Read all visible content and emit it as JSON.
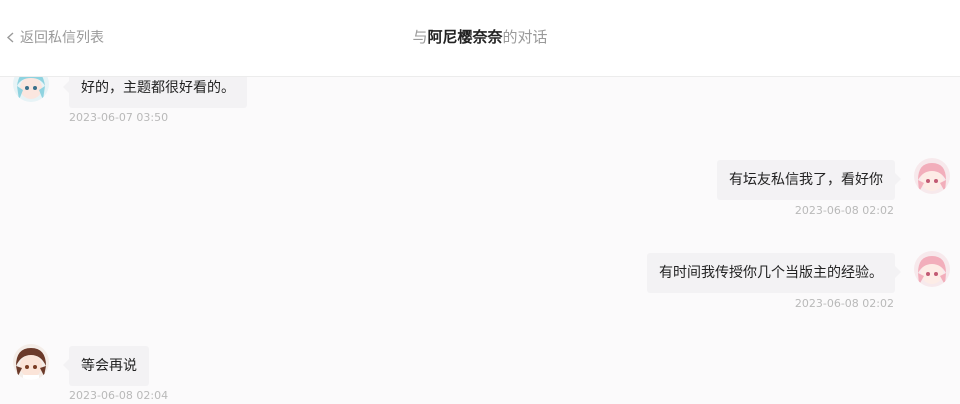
{
  "header": {
    "back_label": "返回私信列表",
    "title_prefix": "与",
    "title_name": "阿尼樱奈奈",
    "title_suffix": "的对话"
  },
  "messages": [
    {
      "side": "left",
      "text": "好的，主题都很好看的。",
      "time": "2023-06-07 03:50",
      "avatar": "cyan-hair-avatar"
    },
    {
      "side": "right",
      "text": "有坛友私信我了，看好你",
      "time": "2023-06-08 02:02",
      "avatar": "pink-hair-avatar"
    },
    {
      "side": "right",
      "text": "有时间我传授你几个当版主的经验。",
      "time": "2023-06-08 02:02",
      "avatar": "pink-hair-avatar"
    },
    {
      "side": "left",
      "text": "等会再说",
      "time": "2023-06-08 02:04",
      "avatar": "brown-hair-avatar"
    }
  ],
  "colors": {
    "background": "#fbfafb",
    "bubble": "#f3f2f4",
    "muted_text": "#9a9a9a",
    "timestamp": "#b9b9b9"
  }
}
